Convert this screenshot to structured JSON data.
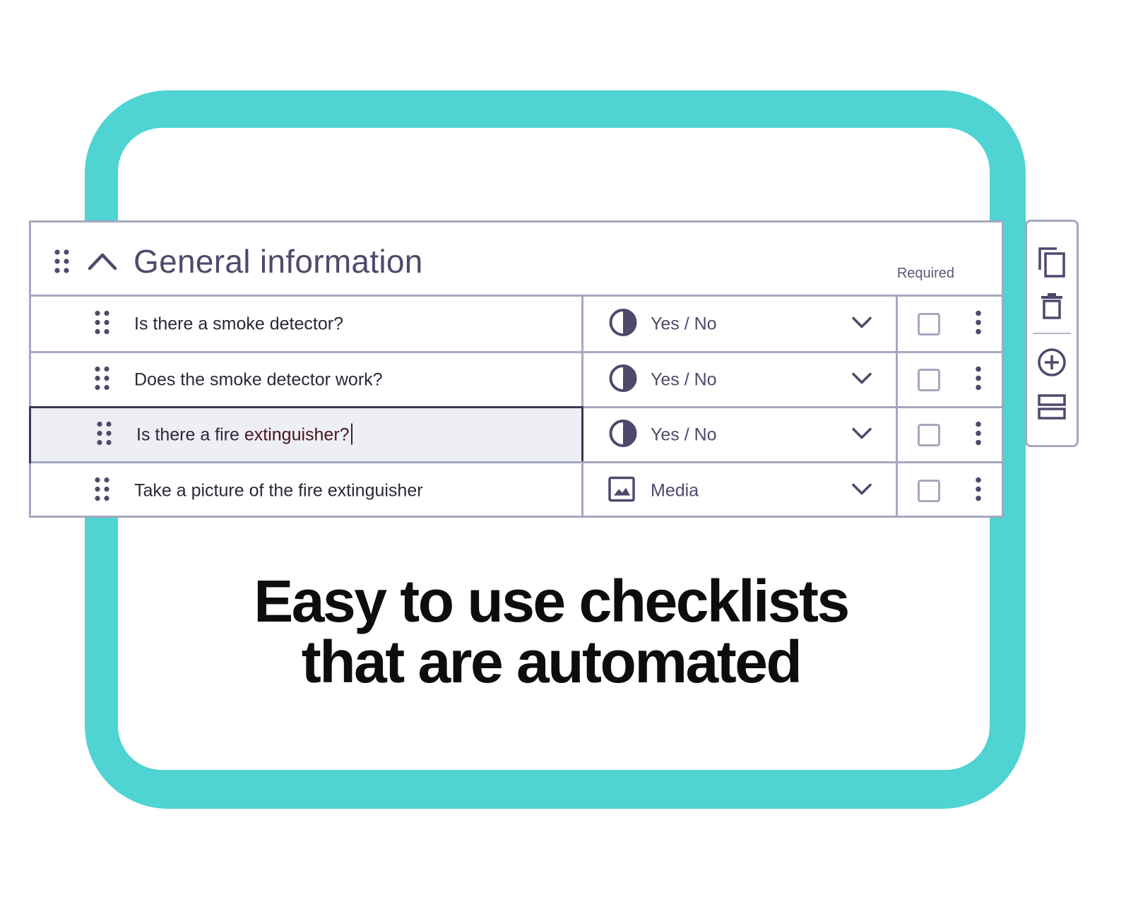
{
  "section": {
    "title": "General information",
    "required_label": "Required"
  },
  "rows": [
    {
      "question": "Is there a smoke detector?",
      "type": "Yes / No",
      "type_icon": "contrast-icon",
      "required": false
    },
    {
      "question": "Does the smoke detector work?",
      "type": "Yes / No",
      "type_icon": "contrast-icon",
      "required": false
    },
    {
      "question_prefix": "Is there a fire ",
      "question_highlight": "extinguisher?",
      "type": "Yes / No",
      "type_icon": "contrast-icon",
      "required": false,
      "editing": true
    },
    {
      "question": "Take a picture of the fire extinguisher",
      "type": "Media",
      "type_icon": "image-icon",
      "required": false
    }
  ],
  "toolbar": {
    "icons": [
      "copy-icon",
      "trash-icon",
      "add-circle-icon",
      "add-section-icon"
    ]
  },
  "headline": {
    "line1": "Easy to use checklists",
    "line2_prefix": "that are ",
    "line2_highlight": "automated"
  },
  "colors": {
    "accent": "#4fd3d3",
    "border": "#a5a8be",
    "text_dark": "#4d4a6b"
  }
}
